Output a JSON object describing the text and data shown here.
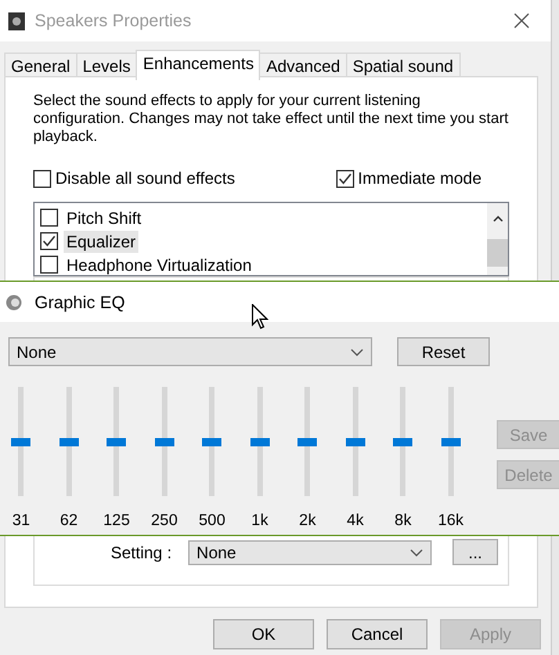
{
  "dialog": {
    "title": "Speakers Properties",
    "tabs": [
      {
        "label": "General",
        "selected": false
      },
      {
        "label": "Levels",
        "selected": false
      },
      {
        "label": "Enhancements",
        "selected": true
      },
      {
        "label": "Advanced",
        "selected": false
      },
      {
        "label": "Spatial sound",
        "selected": false
      }
    ],
    "description": "Select the sound effects to apply for your current listening configuration. Changes may not take effect until the next time you start playback.",
    "options": [
      {
        "label": "Disable all sound effects",
        "checked": false
      },
      {
        "label": "Immediate mode",
        "checked": true
      }
    ],
    "effects": [
      {
        "label": "Pitch Shift",
        "checked": false,
        "selected": false
      },
      {
        "label": "Equalizer",
        "checked": true,
        "selected": true
      },
      {
        "label": "Headphone Virtualization",
        "checked": false,
        "selected": false
      }
    ],
    "setting": {
      "label": "Setting :",
      "value": "None"
    },
    "more_button": "...",
    "buttons": [
      {
        "label": "OK",
        "disabled": false
      },
      {
        "label": "Cancel",
        "disabled": false
      },
      {
        "label": "Apply",
        "disabled": true
      }
    ]
  },
  "equalizer": {
    "title": "Graphic EQ",
    "preset": "None",
    "reset_button": "Reset",
    "bands": [
      {
        "label": "31",
        "level": 0.5
      },
      {
        "label": "62",
        "level": 0.5
      },
      {
        "label": "125",
        "level": 0.5
      },
      {
        "label": "250",
        "level": 0.5
      },
      {
        "label": "500",
        "level": 0.5
      },
      {
        "label": "1k",
        "level": 0.5
      },
      {
        "label": "2k",
        "level": 0.5
      },
      {
        "label": "4k",
        "level": 0.5
      },
      {
        "label": "8k",
        "level": 0.5
      },
      {
        "label": "16k",
        "level": 0.5
      }
    ],
    "side_buttons": [
      {
        "label": "Save",
        "disabled": true
      },
      {
        "label": "Delete",
        "disabled": true
      }
    ]
  }
}
